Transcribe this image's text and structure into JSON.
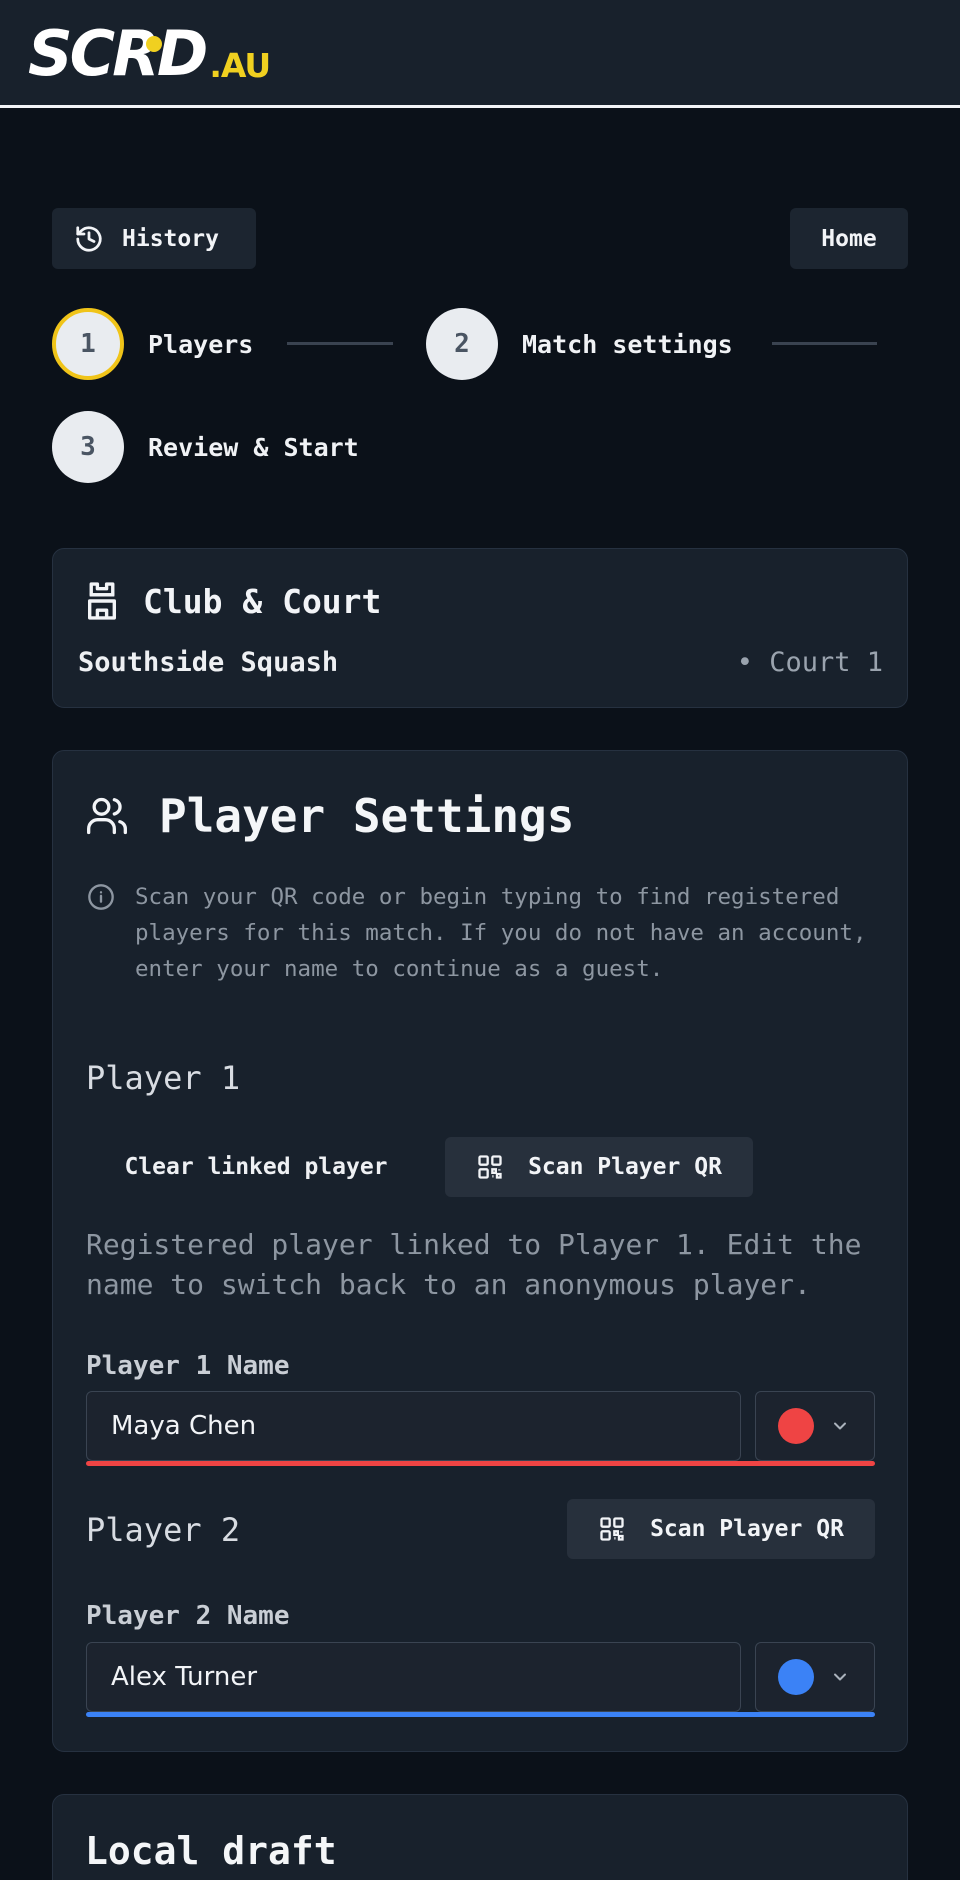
{
  "header": {
    "logo_main": "SCRD",
    "logo_suffix": ".AU",
    "brand_color": "#f0d020"
  },
  "nav": {
    "history_label": "History",
    "home_label": "Home"
  },
  "stepper": {
    "steps": [
      {
        "number": "1",
        "label": "Players",
        "state": "active"
      },
      {
        "number": "2",
        "label": "Match settings",
        "state": "upcoming"
      },
      {
        "number": "3",
        "label": "Review & Start",
        "state": "upcoming"
      }
    ],
    "active_color": "#f0c419"
  },
  "club_card": {
    "title": "Club & Court",
    "club_name": "Southside Squash",
    "court": "• Court 1"
  },
  "player_settings": {
    "title": "Player Settings",
    "info": "Scan your QR code or begin typing to find registered players for this match. If you do not have an account, enter your name to continue as a guest.",
    "player1": {
      "heading": "Player 1",
      "clear_label": "Clear linked player",
      "scan_label": "Scan Player QR",
      "note": "Registered player linked to Player 1. Edit the name to switch back to an anonymous player.",
      "field_label": "Player 1 Name",
      "name_value": "Maya Chen",
      "color": "#ef4444"
    },
    "player2": {
      "heading": "Player 2",
      "scan_label": "Scan Player QR",
      "field_label": "Player 2 Name",
      "name_value": "Alex Turner",
      "color": "#3b82f6"
    }
  },
  "draft_card": {
    "title": "Local draft"
  }
}
